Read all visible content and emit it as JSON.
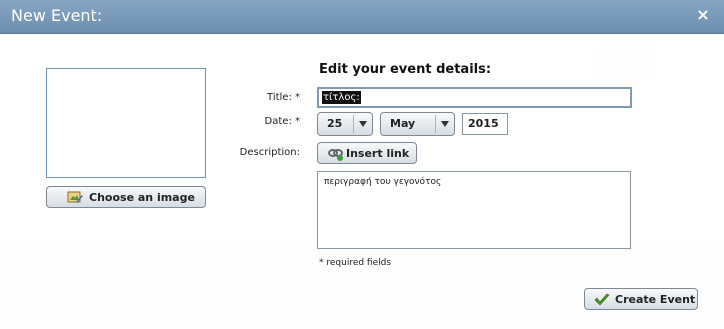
{
  "dialog": {
    "title": "New Event:",
    "close_label": "×"
  },
  "image": {
    "choose_label": "Choose an image"
  },
  "form": {
    "heading": "Edit your event details:",
    "title_label": "Title: *",
    "title_value": "τίτλος:",
    "date_label": "Date: *",
    "day": "25",
    "month": "May",
    "year": "2015",
    "description_label": "Description:",
    "insert_link_label": "Insert link",
    "description_value": "περιγραφή του γεγονότος",
    "required_note": "* required fields"
  },
  "footer": {
    "create_label": "Create Event"
  },
  "icons": {
    "close": "close-icon",
    "choose_image": "image-edit-icon",
    "insert_link": "link-icon",
    "create": "checkmark-icon"
  }
}
